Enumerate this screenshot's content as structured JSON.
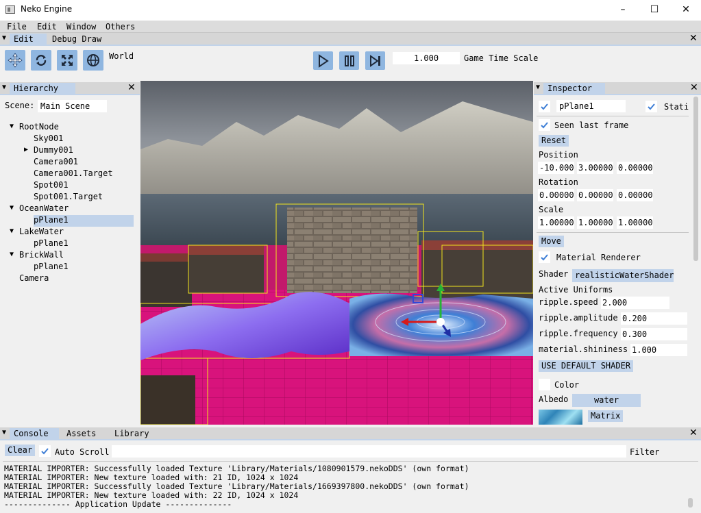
{
  "window": {
    "title": "Neko Engine"
  },
  "menu": [
    "File",
    "Edit",
    "Window",
    "Others"
  ],
  "top_tabs": [
    "Edit",
    "Debug Draw"
  ],
  "toolbar": {
    "space_label": "World",
    "time_scale_value": "1.000",
    "time_scale_label": "Game Time Scale",
    "tool_icons": [
      "move-icon",
      "rotate-icon",
      "scale-icon",
      "globe-icon"
    ],
    "play_icons": [
      "play-icon",
      "pause-icon",
      "step-icon"
    ]
  },
  "hierarchy": {
    "title": "Hierarchy",
    "scene_label": "Scene:",
    "scene_name": "Main Scene",
    "items": [
      {
        "label": "RootNode",
        "arrow": "▼"
      },
      {
        "label": "Sky001",
        "arrow": ""
      },
      {
        "label": "Dummy001",
        "arrow": "▶"
      },
      {
        "label": "Camera001",
        "arrow": ""
      },
      {
        "label": "Camera001.Target",
        "arrow": ""
      },
      {
        "label": "Spot001",
        "arrow": ""
      },
      {
        "label": "Spot001.Target",
        "arrow": ""
      },
      {
        "label": "OceanWater",
        "arrow": "▼"
      },
      {
        "label": "pPlane1",
        "arrow": ""
      },
      {
        "label": "LakeWater",
        "arrow": "▼"
      },
      {
        "label": "pPlane1",
        "arrow": ""
      },
      {
        "label": "BrickWall",
        "arrow": "▼"
      },
      {
        "label": "pPlane1",
        "arrow": ""
      },
      {
        "label": "Camera",
        "arrow": ""
      }
    ]
  },
  "inspector": {
    "title": "Inspector",
    "object_name": "pPlane1",
    "static_label": "Stati",
    "seen_label": "Seen last frame",
    "reset_label": "Reset",
    "position_label": "Position",
    "position": [
      "-10.000",
      "3.00000",
      "0.00000"
    ],
    "rotation_label": "Rotation",
    "rotation": [
      "0.00000",
      "0.00000",
      "0.00000"
    ],
    "scale_label": "Scale",
    "scale": [
      "1.00000",
      "1.00000",
      "1.00000"
    ],
    "move_label": "Move",
    "material_renderer_label": "Material Renderer",
    "shader_label": "Shader",
    "shader_value": "realisticWaterShader",
    "active_uniforms_label": "Active Uniforms",
    "uniforms": [
      {
        "name": "ripple.speed",
        "value": "2.000"
      },
      {
        "name": "ripple.amplitude",
        "value": "0.200"
      },
      {
        "name": "ripple.frequency",
        "value": "0.300"
      },
      {
        "name": "material.shininess",
        "value": "1.000"
      }
    ],
    "default_shader_label": "USE DEFAULT SHADER",
    "color_label": "Color",
    "albedo_label": "Albedo",
    "albedo_value": "water",
    "matrix_label": "Matrix"
  },
  "bottom_tabs": [
    "Console",
    "Assets",
    "Library"
  ],
  "console": {
    "clear_label": "Clear",
    "auto_scroll_label": "Auto Scroll",
    "filter_label": "Filter",
    "lines": [
      "MATERIAL IMPORTER: Successfully loaded Texture 'Library/Materials/1080901579.nekoDDS' (own format)",
      "MATERIAL IMPORTER: New texture loaded with: 21 ID, 1024 x 1024",
      "MATERIAL IMPORTER: Successfully loaded Texture 'Library/Materials/1669397800.nekoDDS' (own format)",
      "MATERIAL IMPORTER: New texture loaded with: 22 ID, 1024 x 1024",
      "-------------- Application Update --------------"
    ]
  },
  "colors": {
    "accent": "#c1d3ea",
    "tool_button": "#8fb6e0",
    "tab_bar": "#d6d6d6"
  }
}
